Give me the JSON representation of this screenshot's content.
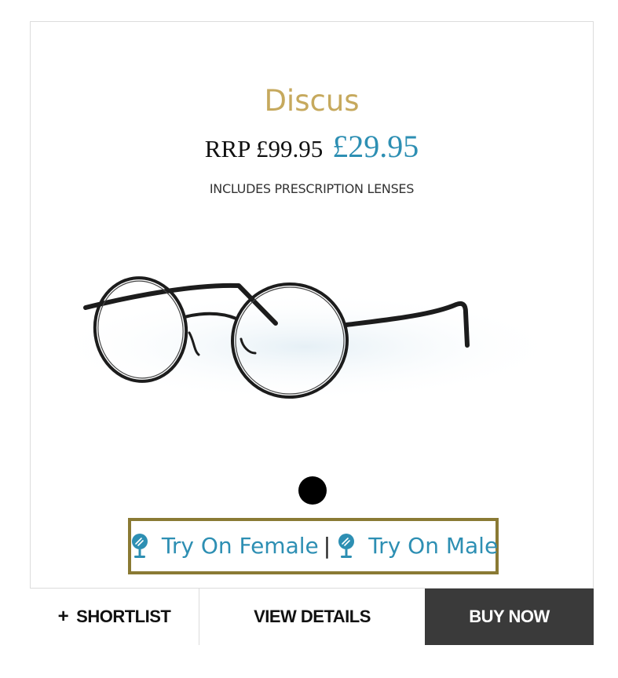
{
  "product": {
    "name": "Discus",
    "rrp_label": "RRP £99.95",
    "price": "£29.95",
    "includes_note": "INCLUDES PRESCRIPTION LENSES",
    "image_icon": "round-metal-glasses-image"
  },
  "carousel": {
    "slide_count": 1,
    "active_index": 0
  },
  "try_on": {
    "female_label": "Try On Female",
    "male_label": "Try On Male",
    "separator": "|",
    "icon": "mirror-icon"
  },
  "actions": {
    "shortlist_plus": "+",
    "shortlist_label": "SHORTLIST",
    "details_label": "VIEW DETAILS",
    "buy_label": "BUY NOW"
  },
  "colors": {
    "title_gold": "#c6a95d",
    "price_blue": "#2d8fb3",
    "try_on_border": "#8a7a34",
    "buy_button_bg": "#3a3a3a"
  }
}
